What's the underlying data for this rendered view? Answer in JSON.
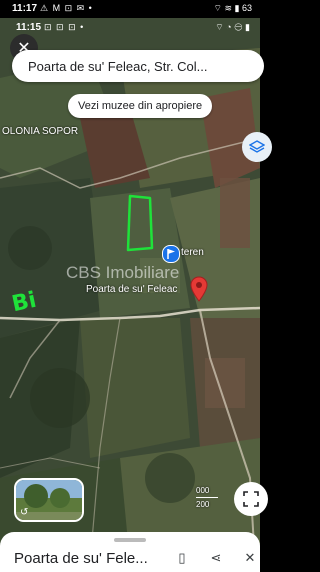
{
  "status_outer": {
    "time": "11:17",
    "notif_icons": "⚠ M ⊡ ✉ •",
    "right_icons": "⌔ ≋ ▮ 63"
  },
  "status_inner": {
    "time": "11:15",
    "notif_icons": "⊡ ⊡ ⊡ •",
    "right_icons": "⌔ ◔ ⊖ ▮"
  },
  "search": {
    "text": "Poarta de su' Feleac, Str. Col..."
  },
  "nearby_button": {
    "label": "Vezi muzee din apropiere"
  },
  "map_labels": {
    "area": "OLONIA SOPOR",
    "poi_pin_label": "teren",
    "place_label": "Poarta de su' Feleac",
    "watermark": "CBS Imobiliare",
    "scale_top": "000",
    "scale_bottom": "200"
  },
  "annotation_text": "Bi",
  "bottom_sheet": {
    "title": "Poarta de su' Fele..."
  },
  "colors": {
    "annotation": "#1fe23a",
    "pin_red": "#e53935",
    "poi_blue": "#1a73e8"
  }
}
